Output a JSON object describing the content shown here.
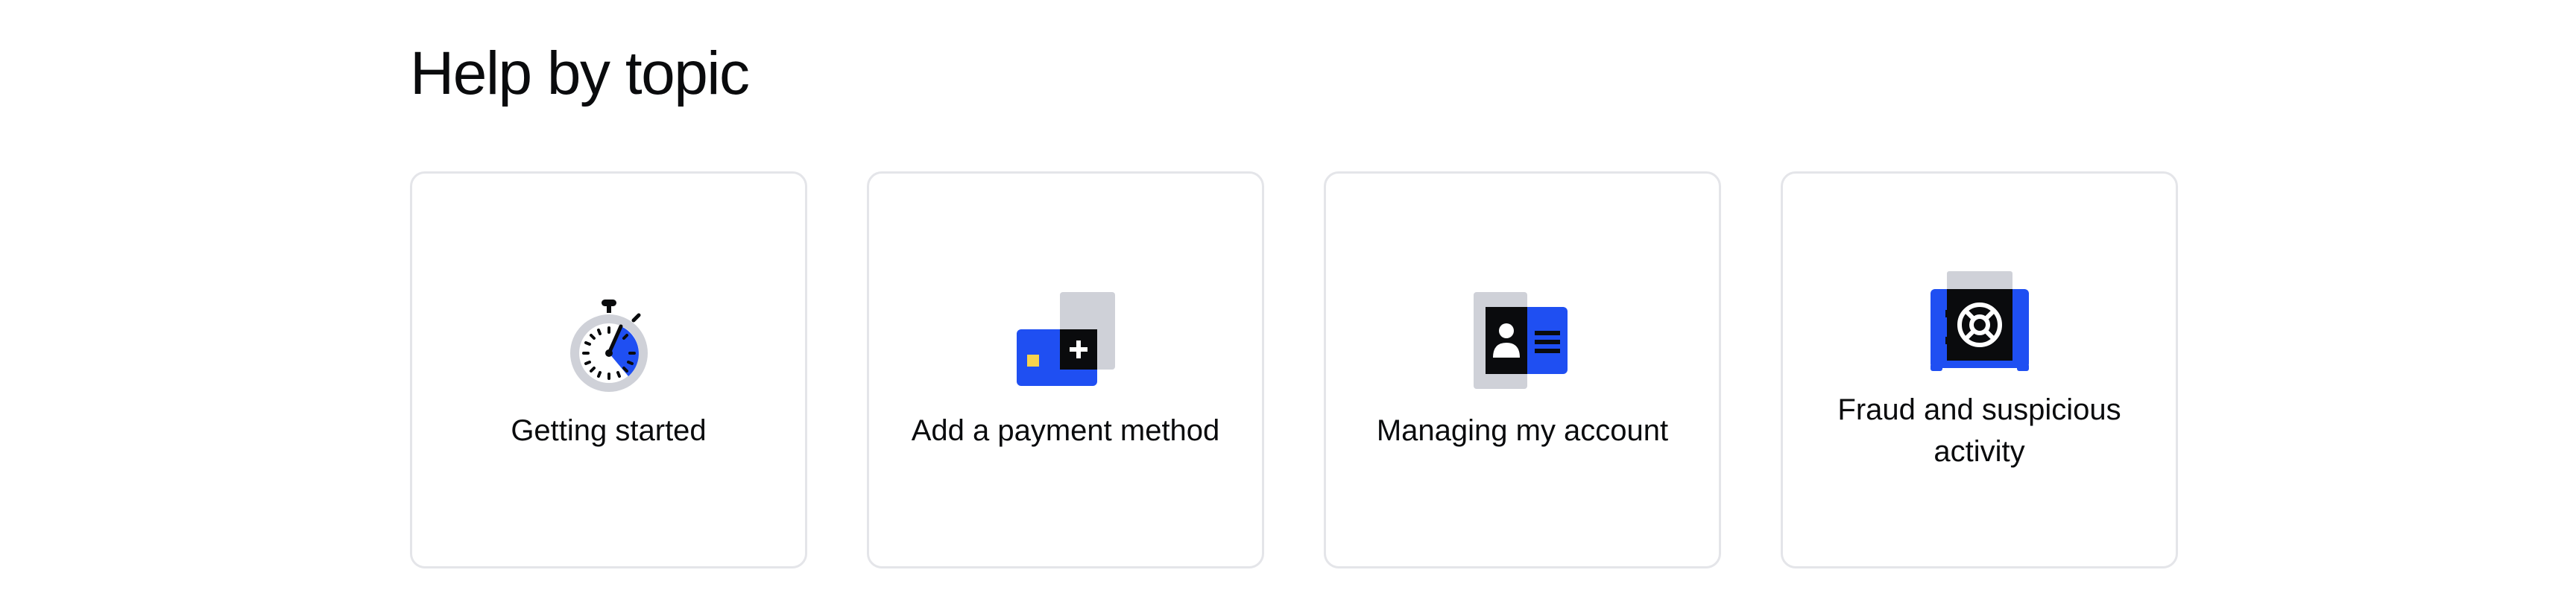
{
  "section": {
    "title": "Help by topic"
  },
  "colors": {
    "accent_blue": "#1f4ff2",
    "icon_gray": "#cfd1d8",
    "icon_black": "#0a0b0d",
    "card_border": "#e4e5e9"
  },
  "topics": [
    {
      "label": "Getting started",
      "icon": "stopwatch-icon"
    },
    {
      "label": "Add a payment method",
      "icon": "credit-card-add-icon"
    },
    {
      "label": "Managing my account",
      "icon": "id-card-icon"
    },
    {
      "label": "Fraud and suspicious activity",
      "icon": "safe-lifebuoy-icon"
    }
  ]
}
